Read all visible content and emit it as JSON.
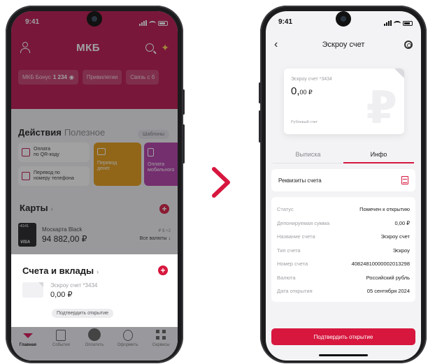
{
  "left_phone": {
    "status": {
      "time": "9:41"
    },
    "header": {
      "logo": "МКБ"
    },
    "chips": [
      {
        "label": "МКБ Бонус",
        "value": "1 234"
      },
      {
        "label": "Привилегии"
      },
      {
        "label": "Связь с б"
      }
    ],
    "actions": {
      "title": "Действия",
      "alt_title": "Полезное",
      "templates": "Шаблоны",
      "tiles": [
        {
          "label_1": "Оплата",
          "label_2": "по QR-коду"
        },
        {
          "label_1": "Перевод по",
          "label_2": "номеру телефона"
        },
        {
          "label_1": "Перевод",
          "label_2": "денег",
          "color": "#e39a12"
        },
        {
          "label_1": "Оплата",
          "label_2": "мобильного",
          "color": "#b23ca8"
        }
      ]
    },
    "cards": {
      "title": "Карты",
      "suffix": "›",
      "item": {
        "number": "•6141",
        "brand": "VISA",
        "name": "Москарта Black",
        "amount": "94 882,00 ₽",
        "currencies": "₽ $ +2",
        "all_currencies": "Все валюты ↓"
      }
    },
    "accounts": {
      "title": "Счета и вклады",
      "suffix": "›",
      "item": {
        "name": "Эскроу счет *3434",
        "amount": "0,00 ₽",
        "action": "Подтвердить открытие"
      }
    },
    "tabbar": [
      {
        "label": "Главная",
        "icon": "main-icon"
      },
      {
        "label": "События",
        "icon": "events-icon"
      },
      {
        "label": "Оплатить",
        "icon": "pay-icon"
      },
      {
        "label": "Оформить",
        "icon": "issue-icon"
      },
      {
        "label": "Сервисы",
        "icon": "services-icon"
      }
    ],
    "accent": "#b8124a"
  },
  "right_phone": {
    "status": {
      "time": "9:41"
    },
    "nav": {
      "back": "‹",
      "title": "Эскроу счет"
    },
    "escrow_card": {
      "name": "Эскроу счет *3434",
      "amount_int": "0,",
      "amount_dec": "00 ₽",
      "footer": "Рублевый счет",
      "watermark": "₽"
    },
    "tabs": [
      {
        "label": "Выписка",
        "active": false
      },
      {
        "label": "Инфо",
        "active": true
      }
    ],
    "requisites": "Реквизиты счета",
    "info": [
      {
        "key": "Статус",
        "value": "Помечен к открытию"
      },
      {
        "key": "Депонируемая сумма",
        "value": "0,00 ₽"
      },
      {
        "key": "Название счета",
        "value": "Эскроу счет"
      },
      {
        "key": "Тип счета",
        "value": "Эскроу"
      },
      {
        "key": "Номер счета",
        "value": "40824810000002013298"
      },
      {
        "key": "Валюта",
        "value": "Российский рубль"
      },
      {
        "key": "Дата открытия",
        "value": "05 сентября 2024"
      }
    ],
    "confirm_button": "Подтвердить открытие",
    "accent": "#d7173e"
  }
}
